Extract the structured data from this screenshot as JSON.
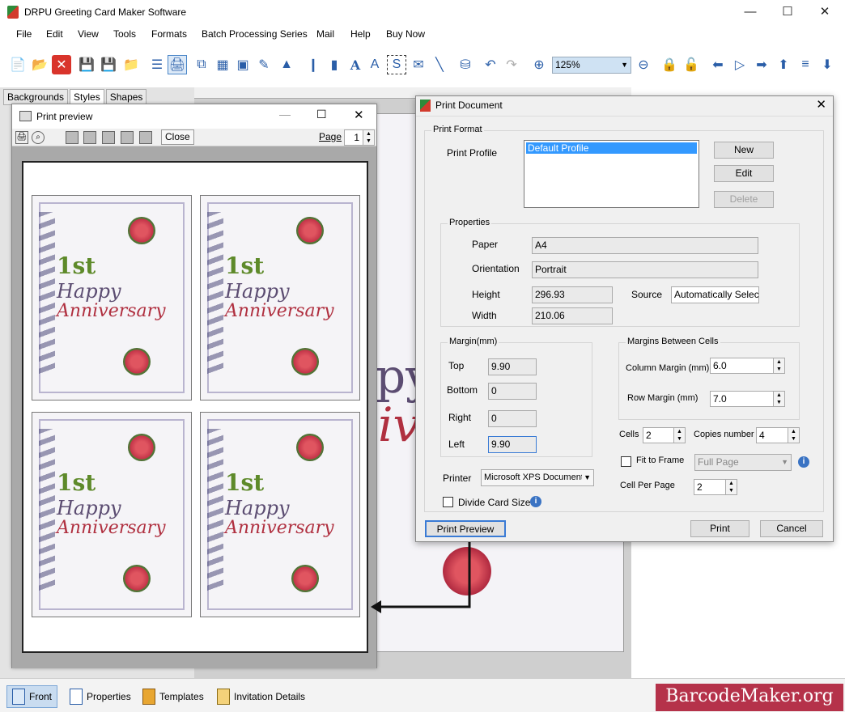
{
  "app": {
    "title": "DRPU Greeting Card Maker Software"
  },
  "menu": [
    "File",
    "Edit",
    "View",
    "Tools",
    "Formats",
    "Batch Processing Series",
    "Mail",
    "Help",
    "Buy Now"
  ],
  "toolbar": {
    "zoom": "125%"
  },
  "left_tabs": [
    "Backgrounds",
    "Styles",
    "Shapes"
  ],
  "preview": {
    "title": "Print preview",
    "close_label": "Close",
    "page_label": "Page",
    "page_value": "1",
    "card": {
      "line1": "1st",
      "line2": "Happy",
      "line3": "Anniversary"
    }
  },
  "canvas": {
    "big1": "py",
    "big2": "iv"
  },
  "dialog": {
    "title": "Print Document",
    "print_format": "Print Format",
    "print_profile_label": "Print Profile",
    "profiles": [
      "Default Profile"
    ],
    "btn_new": "New",
    "btn_edit": "Edit",
    "btn_delete": "Delete",
    "properties": "Properties",
    "paper_label": "Paper",
    "paper_value": "A4",
    "orientation_label": "Orientation",
    "orientation_value": "Portrait",
    "height_label": "Height",
    "height_value": "296.93",
    "source_label": "Source",
    "source_value": "Automatically Selec",
    "width_label": "Width",
    "width_value": "210.06",
    "margin_group": "Margin(mm)",
    "top_label": "Top",
    "top_value": "9.90",
    "bottom_label": "Bottom",
    "bottom_value": "0",
    "right_label": "Right",
    "right_value": "0",
    "left_label": "Left",
    "left_value": "9.90",
    "mbc_group": "Margins Between Cells",
    "col_margin_label": "Column Margin (mm)",
    "col_margin_value": "6.0",
    "row_margin_label": "Row Margin (mm)",
    "row_margin_value": "7.0",
    "cells_label": "Cells",
    "cells_value": "2",
    "copies_label": "Copies number",
    "copies_value": "4",
    "printer_label": "Printer",
    "printer_value": "Microsoft XPS Document",
    "fit_label": "Fit to Frame",
    "fit_value": "Full Page",
    "divide_label": "Divide Card Size",
    "cell_per_page_label": "Cell Per Page",
    "cell_per_page_value": "2",
    "btn_preview": "Print Preview",
    "btn_print": "Print",
    "btn_cancel": "Cancel"
  },
  "status": {
    "front": "Front",
    "properties": "Properties",
    "templates": "Templates",
    "invitation": "Invitation Details"
  },
  "brand": "BarcodeMaker.org"
}
